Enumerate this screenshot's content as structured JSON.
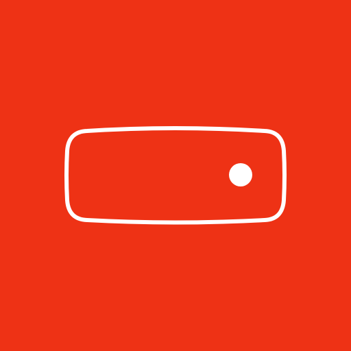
{
  "app_icon": {
    "icon": "hard-drive-icon",
    "colors": {
      "background": "#EE3215",
      "foreground": "#FFFFFF"
    }
  }
}
